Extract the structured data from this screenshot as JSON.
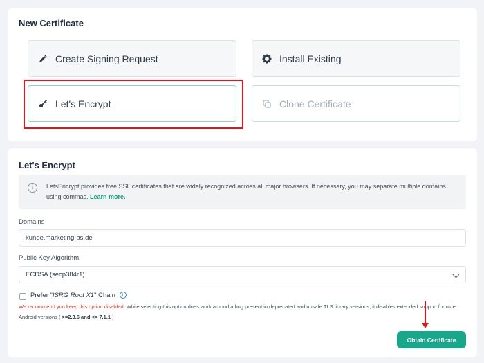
{
  "new_certificate": {
    "title": "New Certificate",
    "options": [
      {
        "label": "Create Signing Request",
        "icon": "pencil-icon"
      },
      {
        "label": "Install Existing",
        "icon": "gear-icon"
      },
      {
        "label": "Let's Encrypt",
        "icon": "key-icon",
        "selected": true
      },
      {
        "label": "Clone Certificate",
        "icon": "copy-icon",
        "disabled": true
      }
    ]
  },
  "lets_encrypt": {
    "title": "Let's Encrypt",
    "info_text": "LetsEncrypt provides free SSL certificates that are widely recognized across all major browsers. If necessary, you may separate multiple domains using commas.",
    "info_link": "Learn more.",
    "domains_label": "Domains",
    "domains_value": "kunde.marketing-bs.de",
    "algorithm_label": "Public Key Algorithm",
    "algorithm_value": "ECDSA (secp384r1)",
    "prefer_prefix": "Prefer \"",
    "prefer_chain": "ISRG Root X1",
    "prefer_suffix": "\" Chain",
    "warning_red": "We recommend you keep this option disabled.",
    "warning_text": " While selecting this option does work around a bug present in deprecated and unsafe TLS library versions, it disables extended support for older Android versions (",
    "warning_versions": " >=2.3.6 and <= 7.1.1",
    "warning_close": " )",
    "obtain_button": "Obtain Certificate"
  },
  "colors": {
    "accent": "#17a88b",
    "annotation": "#e3141b",
    "warning": "#e0362c"
  }
}
